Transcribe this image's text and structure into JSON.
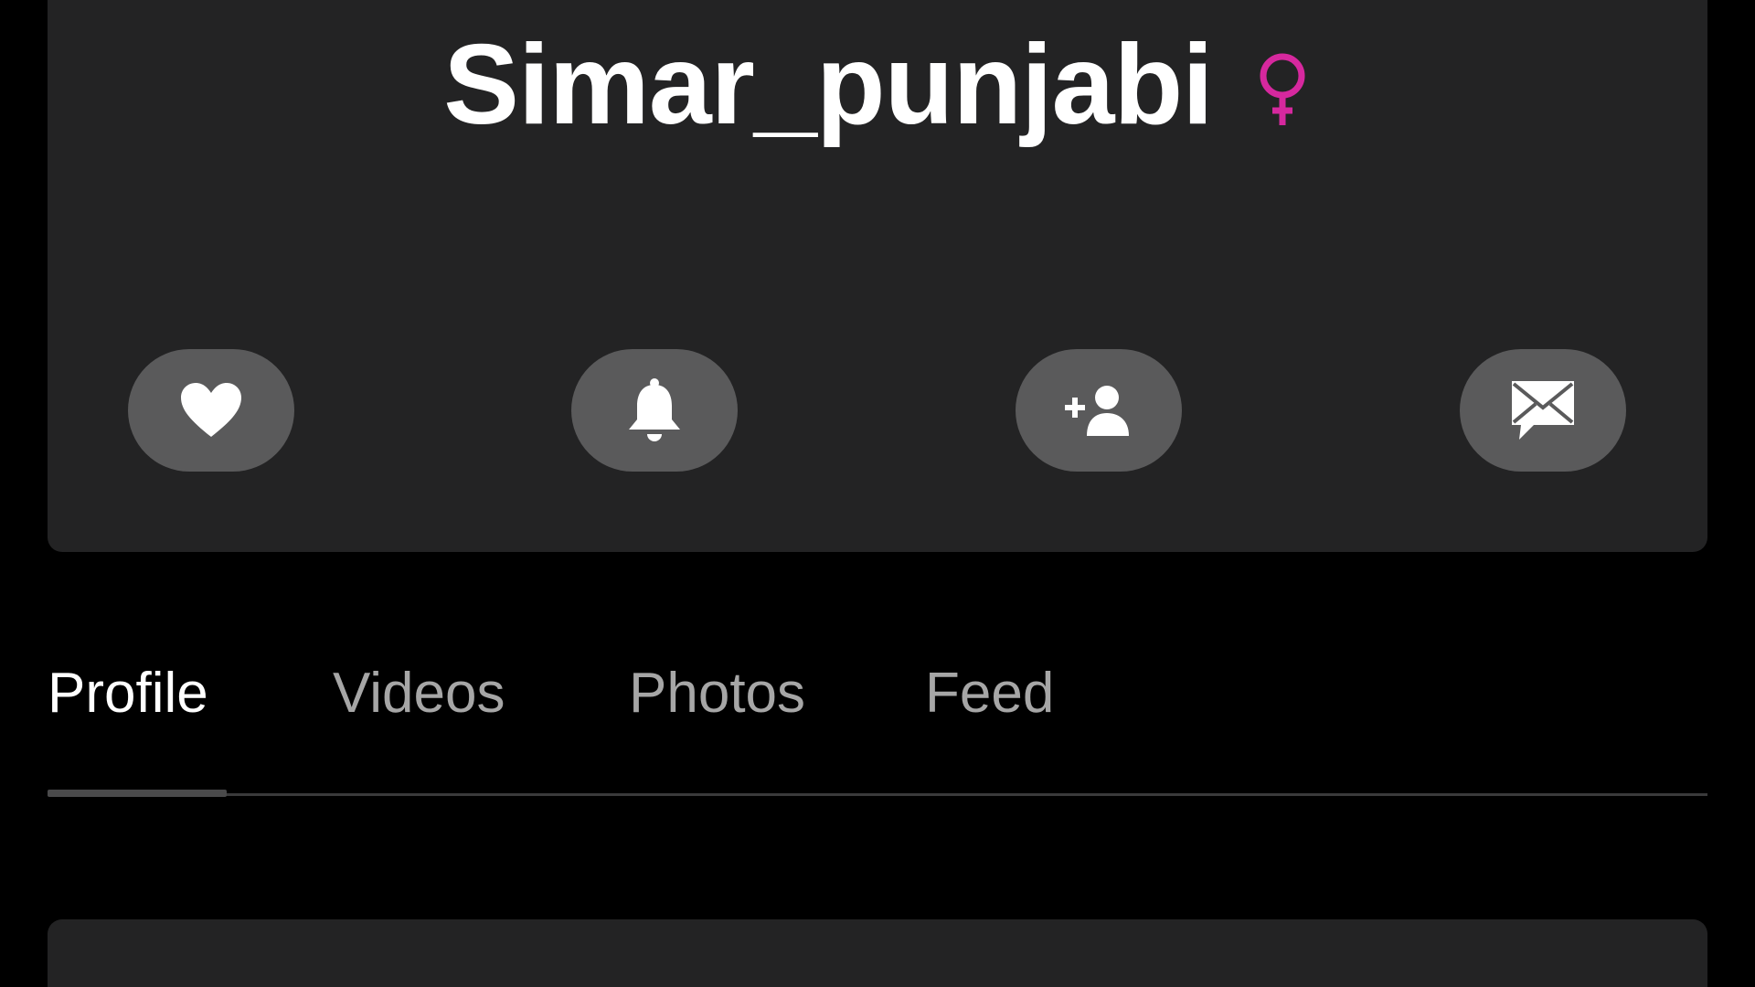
{
  "profile": {
    "username": "Simar_punjabi",
    "gender_icon": "female-symbol-icon",
    "gender_color": "#d6289e"
  },
  "actions": [
    {
      "name": "like-button",
      "icon": "heart-icon"
    },
    {
      "name": "notify-button",
      "icon": "bell-icon"
    },
    {
      "name": "add-friend-button",
      "icon": "add-user-icon"
    },
    {
      "name": "message-button",
      "icon": "mail-chat-icon"
    }
  ],
  "tabs": {
    "items": [
      {
        "label": "Profile",
        "active": true
      },
      {
        "label": "Videos",
        "active": false
      },
      {
        "label": "Photos",
        "active": false
      },
      {
        "label": "Feed",
        "active": false
      }
    ]
  },
  "colors": {
    "background": "#000000",
    "card": "#232324",
    "button": "#5a5a5b",
    "tab_active": "#ffffff",
    "tab_inactive": "#a6a6a6"
  }
}
